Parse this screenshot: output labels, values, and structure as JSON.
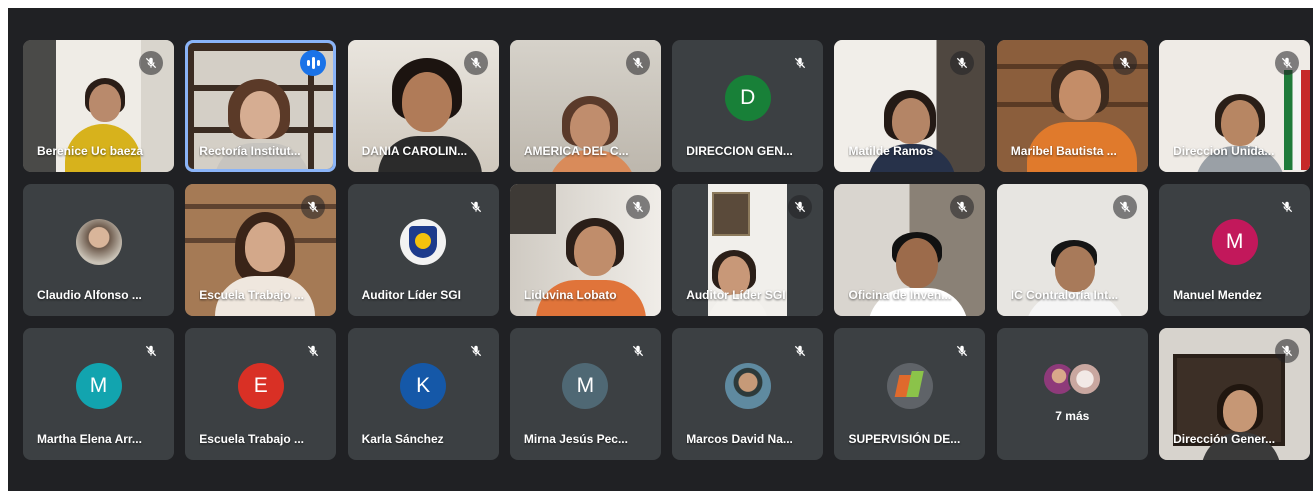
{
  "meeting": {
    "more_label": "7 más",
    "colors": {
      "stage_bg": "#202124",
      "tile_bg": "#3c4043",
      "active_speaker_border": "#8ab4f8",
      "speaking_indicator": "#1a73e8"
    },
    "participants": [
      {
        "name": "Berenice Uc baeza",
        "type": "video",
        "muted": true
      },
      {
        "name": "Rectoría Institut...",
        "type": "video",
        "muted": false,
        "speaking": true
      },
      {
        "name": "DANIA CAROLIN...",
        "type": "video",
        "muted": true
      },
      {
        "name": "AMERICA DEL C...",
        "type": "video",
        "muted": true
      },
      {
        "name": "DIRECCION GEN...",
        "type": "initial",
        "initial": "D",
        "color": "#188038",
        "muted": true
      },
      {
        "name": "Matilde Ramos",
        "type": "video",
        "muted": true
      },
      {
        "name": "Maribel Bautista ...",
        "type": "video",
        "muted": true
      },
      {
        "name": "Direccion Unida...",
        "type": "video",
        "muted": true
      },
      {
        "name": "Claudio Alfonso ...",
        "type": "photo",
        "muted": false
      },
      {
        "name": "Escuela Trabajo ...",
        "type": "video",
        "muted": true
      },
      {
        "name": "Auditor Líder SGI",
        "type": "logo",
        "muted": true
      },
      {
        "name": "Liduvina Lobato",
        "type": "video",
        "muted": true
      },
      {
        "name": "Auditor Líder SGI",
        "type": "video",
        "muted": true
      },
      {
        "name": "Oficina de Inven...",
        "type": "video",
        "muted": true
      },
      {
        "name": "IC Contraloría Int...",
        "type": "video",
        "muted": true
      },
      {
        "name": "Manuel Mendez",
        "type": "initial",
        "initial": "M",
        "color": "#c2185b",
        "muted": true
      },
      {
        "name": "Martha Elena Arr...",
        "type": "initial",
        "initial": "M",
        "color": "#12a4af",
        "muted": true
      },
      {
        "name": "Escuela Trabajo ...",
        "type": "initial",
        "initial": "E",
        "color": "#d93025",
        "muted": true
      },
      {
        "name": "Karla Sánchez",
        "type": "initial",
        "initial": "K",
        "color": "#1558a8",
        "muted": true
      },
      {
        "name": "Mirna Jesús Pec...",
        "type": "initial",
        "initial": "M",
        "color": "#4f6874",
        "muted": true
      },
      {
        "name": "Marcos David Na...",
        "type": "photo",
        "muted": true
      },
      {
        "name": "SUPERVISIÓN DE...",
        "type": "logo",
        "muted": true
      },
      {
        "name": "",
        "type": "more",
        "muted": false
      },
      {
        "name": "Dirección Gener...",
        "type": "video",
        "muted": true
      }
    ]
  }
}
